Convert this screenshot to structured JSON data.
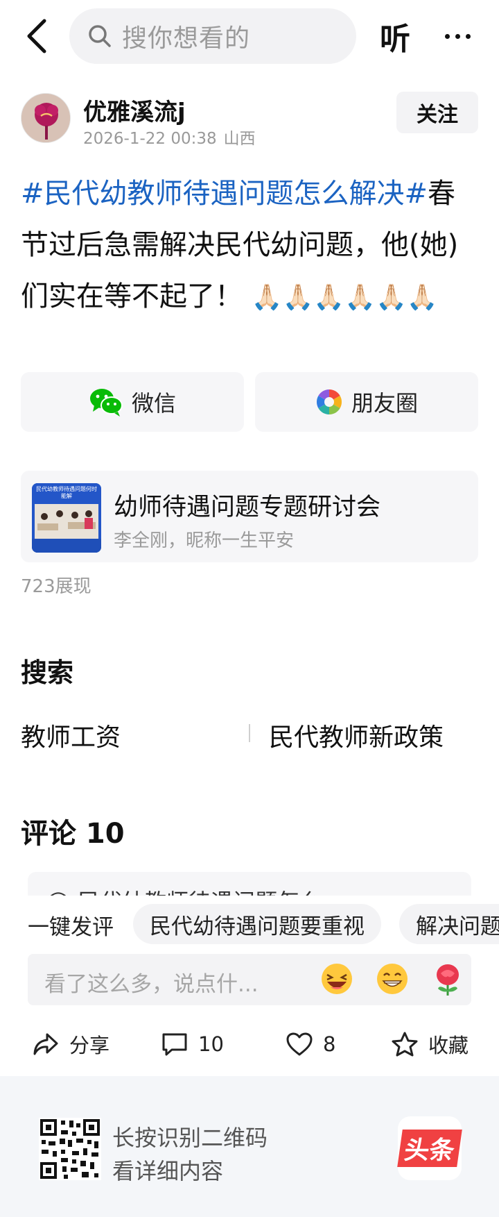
{
  "header": {
    "search_placeholder": "搜你想看的",
    "listen_label": "听"
  },
  "author": {
    "name": "优雅溪流j",
    "datetime": "2026-1-22 00:38",
    "location": "山西",
    "follow_label": "关注"
  },
  "post": {
    "hashtag": "#民代幼教师待遇问题怎么解决#",
    "text": "春节过后急需解决民代幼问题，他(她)们实在等不起了！",
    "emoji": "🙏🏻🙏🏻🙏🏻🙏🏻🙏🏻🙏🏻"
  },
  "share": {
    "wechat_label": "微信",
    "moments_label": "朋友圈"
  },
  "article": {
    "thumb_caption": "民代幼教师待遇问题何时能解",
    "title": "幼师待遇问题专题研讨会",
    "subtitle": "李全刚，昵称一生平安"
  },
  "views_text": "723展现",
  "search_section": {
    "heading": "搜索",
    "terms": [
      "教师工资",
      "民代教师新政策"
    ]
  },
  "comments": {
    "heading": "评论 10",
    "preview_text": "民代幼教师待遇问题怎么"
  },
  "quick_comment": {
    "lead": "一键发评",
    "chips": [
      "民代幼待遇问题要重视",
      "解决问题"
    ]
  },
  "comment_input": {
    "placeholder": "看了这么多，说点什..."
  },
  "actions": {
    "share_label": "分享",
    "comment_count": "10",
    "like_count": "8",
    "favorite_label": "收藏"
  },
  "footer": {
    "line1": "长按识别二维码",
    "line2": "看详细内容",
    "brand": "头条"
  },
  "colors": {
    "hashtag": "#1b63c2",
    "brand_red": "#f04142",
    "wechat_green": "#09bb07"
  }
}
